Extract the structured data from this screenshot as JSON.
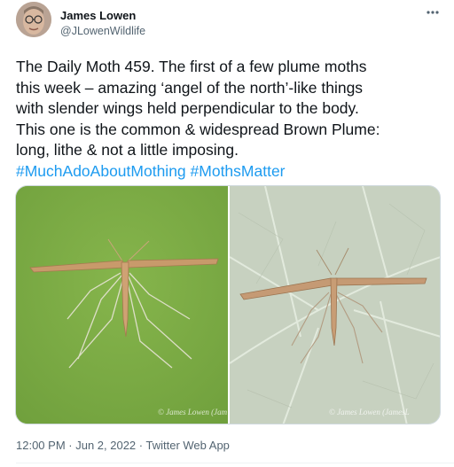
{
  "author": {
    "display_name": "James Lowen",
    "handle": "@JLowenWildlife"
  },
  "more_icon": "more-horizontal-icon",
  "tweet": {
    "lines": [
      "The Daily Moth 459. The first of a few plume moths",
      "this week – amazing ‘angel of the north’-like things",
      "with slender wings held perpendicular to the body.",
      "This one is the common & widespread Brown Plume:",
      "long, lithe & not a little imposing."
    ],
    "hashtags": [
      "#MuchAdoAboutMothing",
      "#MothsMatter"
    ]
  },
  "media": {
    "photos": [
      {
        "watermark": "© James Lowen (Jam"
      },
      {
        "watermark": "© James Lowen (JamesL"
      }
    ]
  },
  "meta": {
    "time": "12:00 PM",
    "separator": " · ",
    "date": "Jun 2, 2022",
    "source": "Twitter Web App"
  },
  "colors": {
    "link": "#1d9bf0",
    "secondary_text": "#536471"
  }
}
